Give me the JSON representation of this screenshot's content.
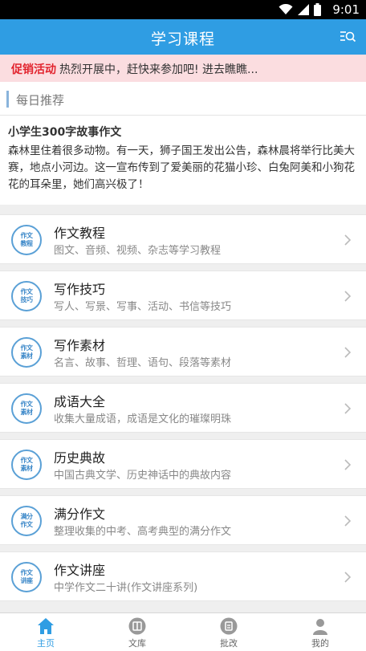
{
  "status_bar": {
    "time": "9:01"
  },
  "header": {
    "title": "学习课程"
  },
  "promo": {
    "tag": "促销活动",
    "message": "热烈开展中，赶快来参加吧! 进去瞧瞧..."
  },
  "recommend": {
    "section_label": "每日推荐",
    "title": "小学生300字故事作文",
    "text": "森林里住着很多动物。有一天，狮子国王发出公告，森林晨将举行比美大赛，地点小河边。这一宣布传到了爱美丽的花猫小珍、白兔阿美和小狗花花的耳朵里，她们高兴极了！"
  },
  "menu": [
    {
      "badge": "作文教程",
      "title": "作文教程",
      "desc": "图文、音频、视频、杂志等学习教程"
    },
    {
      "badge": "作文技巧",
      "title": "写作技巧",
      "desc": "写人、写景、写事、活动、书信等技巧"
    },
    {
      "badge": "作文素材",
      "title": "写作素材",
      "desc": "名言、故事、哲理、语句、段落等素材"
    },
    {
      "badge": "作文素材",
      "title": "成语大全",
      "desc": "收集大量成语，成语是文化的璀璨明珠"
    },
    {
      "badge": "作文素材",
      "title": "历史典故",
      "desc": "中国古典文学、历史神话中的典故内容"
    },
    {
      "badge": "满分作文",
      "title": "满分作文",
      "desc": "整理收集的中考、高考典型的满分作文"
    },
    {
      "badge": "作文讲座",
      "title": "作文讲座",
      "desc": "中学作文二十讲(作文讲座系列)"
    }
  ],
  "tabs": [
    {
      "label": "主页",
      "icon": "home-icon",
      "active": true
    },
    {
      "label": "文库",
      "icon": "library-icon",
      "active": false
    },
    {
      "label": "批改",
      "icon": "edit-icon",
      "active": false
    },
    {
      "label": "我的",
      "icon": "user-icon",
      "active": false
    }
  ],
  "colors": {
    "primary": "#2f9de3",
    "promo_bg": "#fbdde0",
    "promo_tag": "#e2242e",
    "badge": "#5aa0d6"
  }
}
